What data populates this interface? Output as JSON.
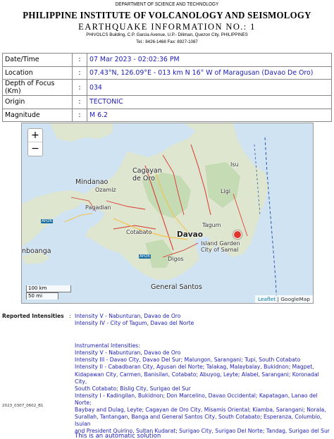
{
  "header": {
    "department": "DEPARTMENT OF SCIENCE AND TECHNOLOGY",
    "institute": "PHILIPPINE INSTITUTE OF VOLCANOLOGY AND SEISMOLOGY",
    "report_title": "EARTHQUAKE INFORMATION NO.: 1",
    "address": "PHIVOLCS Building, C.P. Garcia Avenue, U.P.- Diliman, Quezon City, PHILIPPINES",
    "telephone": "Tel.: 8426-1468  Fax: 8927-1087"
  },
  "details": {
    "rows": [
      {
        "label": "Date/Time",
        "colon": ":",
        "value": "07 Mar 2023 - 02:02:36 PM"
      },
      {
        "label": "Location",
        "colon": ":",
        "value": "07.43°N, 126.09°E - 013 km N 16° W of Maragusan (Davao De Oro)"
      },
      {
        "label": "Depth of Focus (Km)",
        "colon": ":",
        "value": "034"
      },
      {
        "label": "Origin",
        "colon": ":",
        "value": "TECTONIC"
      },
      {
        "label": "Magnitude",
        "colon": ":",
        "value": "M 6.2"
      }
    ]
  },
  "map": {
    "zoom_in": "+",
    "zoom_out": "−",
    "scale_km": "100 km",
    "scale_mi": "50 mi",
    "attribution_leaflet": "Leaflet",
    "attribution_sep": " | ",
    "attribution_google": "GoogleMap",
    "labels": {
      "cagayan": "Cagayan\nde Oro",
      "mindanao": "Mindanao",
      "ozamiz": "Ozamiz",
      "pagadian": "Pagadian",
      "cotabato": "Cotabato",
      "davao": "Davao",
      "tagum": "Tagum",
      "island_garden": "Island Garden\nCity of Samal",
      "digos": "Digos",
      "general_santos": "General Santos",
      "zamboanga": "nboanga",
      "ligi": "Ligi",
      "isu": "Isu",
      "ah26_a": "AH26",
      "ah26_b": "AH26"
    },
    "marker_color": "#e0342b",
    "water_color": "#cfe3f3",
    "land_color": "#dfe6cf"
  },
  "reported": {
    "label": "Reported Intensities",
    "colon": ":",
    "reported_lines": [
      "Intensity V - Nabunturan, Davao de Oro",
      "Intensity IV - City of Tagum, Davao del Norte"
    ],
    "instrumental_title": "Instrumental Intensities:",
    "instrumental_lines": [
      "Intensity V - Nabunturan, Davao de Oro",
      "Intensity III - Davao City, Davao Del Sur; Malungon, Sarangani; Tupi, South Cotabato",
      "Intensity II - Cabadbaran City, Agusan del Norte; Talakag, Malaybalay, Bukidnon; Magpet,",
      "Kidapawan City, Carmen, Banisilan, Cotabato; Abuyog, Leyte; Alabel, Sarangani; Koronadal City,",
      "South Cotabato; Bislig City, Surigao del Sur",
      "Intensity I - Kadingilan, Bukidnon; Don Marcelino, Davao Occidental; Kapatagan, Lanao del Norte;",
      "Baybay and Dulag, Leyte; Cagayan de Oro City, Misamis Oriental; Kiamba, Sarangani; Norala,",
      "Surallah, Tantangan, Banga and General Santos City, South Cotabato; Esperanza, Columbio, Isulan",
      "and President Quirino, Sultan Kudarat; Surigao City, Surigao Del Norte; Tandag, Surigao del Sur"
    ],
    "reference_id": "2023_0307_0602_B1",
    "automatic_note": "This is an automatic solution"
  }
}
